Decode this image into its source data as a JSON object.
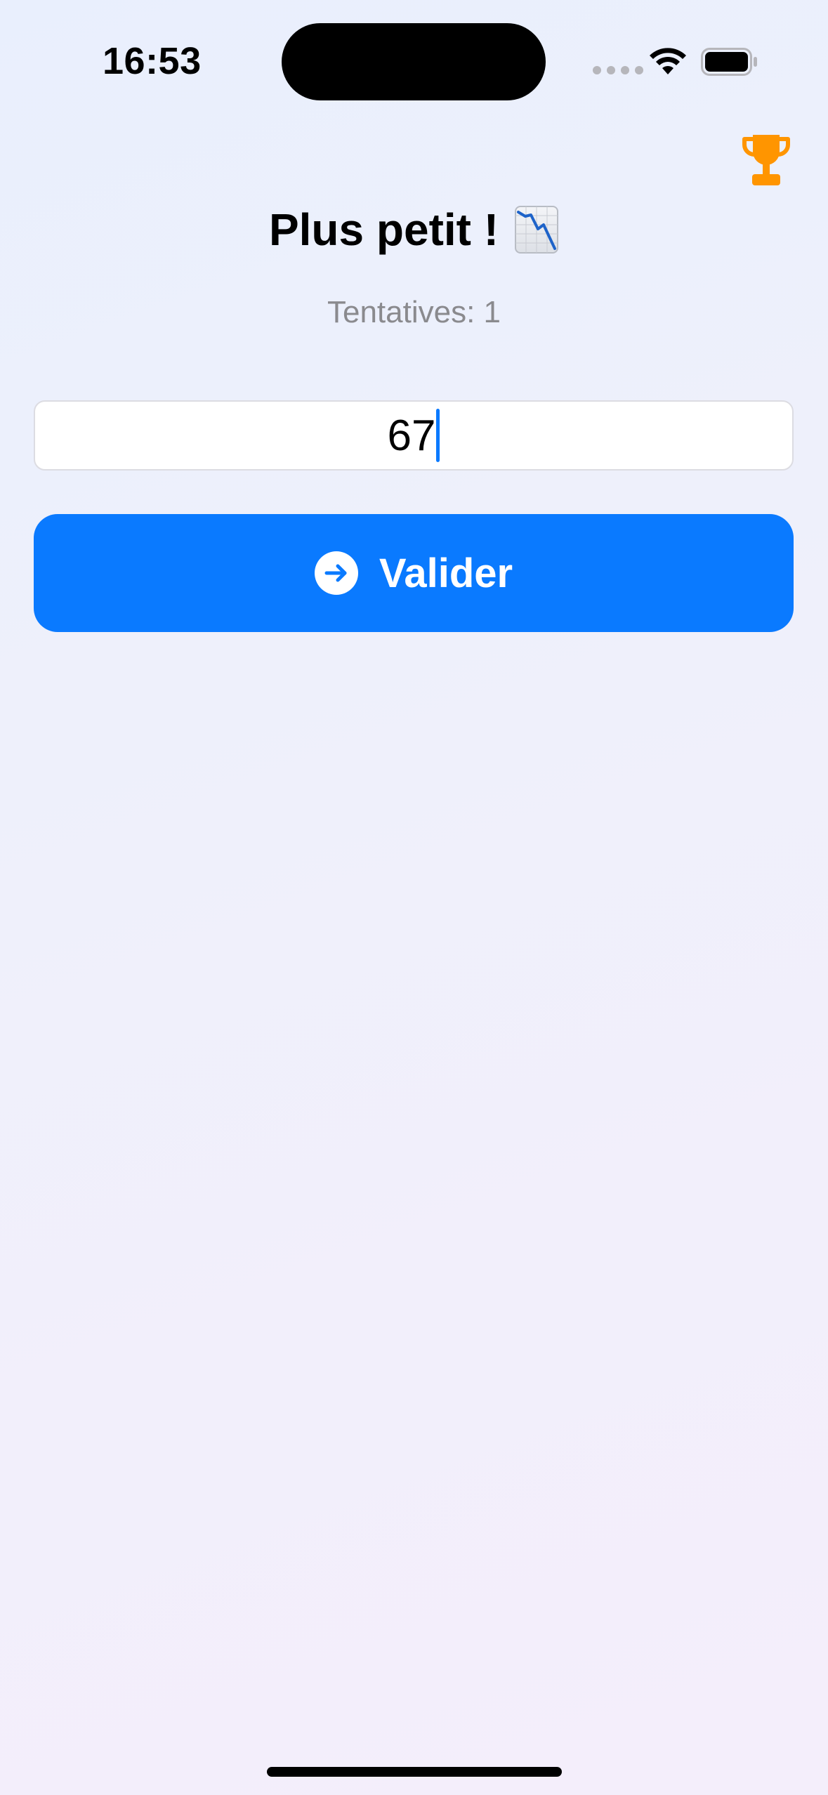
{
  "status_bar": {
    "time": "16:53"
  },
  "header": {
    "trophy_icon": "trophy-icon",
    "title": "Plus petit !",
    "title_icon": "chart-down-icon"
  },
  "game": {
    "attempts_text": "Tentatives: 1",
    "guess_value": "67",
    "validate_label": "Valider",
    "validate_icon": "arrow-right-circle-icon"
  },
  "colors": {
    "accent": "#0a7aff",
    "trophy": "#ff9500",
    "secondary_text": "#8a8a8e"
  }
}
